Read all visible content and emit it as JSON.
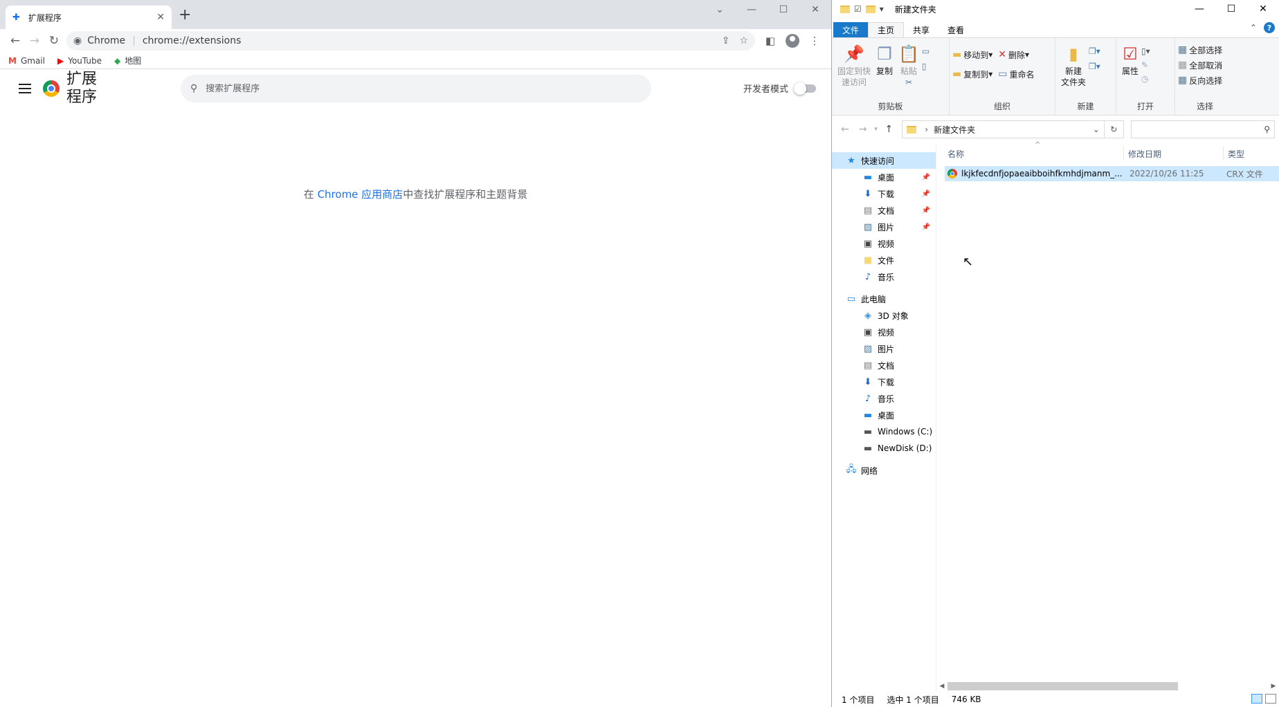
{
  "chrome": {
    "tab": {
      "title": "扩展程序",
      "close": "✕"
    },
    "newtab": "+",
    "window": {
      "minimize": "—",
      "maximize": "☐",
      "close": "✕",
      "tab_search": "⌄"
    },
    "omnibox": {
      "site_name": "Chrome",
      "separator": "|",
      "url": "chrome://extensions"
    },
    "bookmarks": [
      {
        "label": "Gmail",
        "icon": "M",
        "icon_color": "#ea4335"
      },
      {
        "label": "YouTube",
        "icon": "▶",
        "icon_color": "#ff0000"
      },
      {
        "label": "地图",
        "icon": "◆",
        "icon_color": "#34a853"
      }
    ],
    "extensions_page": {
      "title": "扩展 程序",
      "search_placeholder": "搜索扩展程序",
      "dev_mode_label": "开发者模式",
      "dev_mode_on": false,
      "store_msg_prefix": "在 ",
      "store_msg_link": "Chrome 应用商店",
      "store_msg_suffix": "中查找扩展程序和主题背景"
    }
  },
  "explorer": {
    "title": "新建文件夹",
    "ribbon_tabs": [
      "文件",
      "主页",
      "共享",
      "查看"
    ],
    "active_tab": "主页",
    "ribbon": {
      "clipboard": {
        "label": "剪贴板",
        "pin": "固定到快\n速访问",
        "copy": "复制",
        "paste": "粘贴"
      },
      "organize": {
        "label": "组织",
        "move_to": "移动到",
        "copy_to": "复制到",
        "delete": "删除",
        "rename": "重命名"
      },
      "new": {
        "label": "新建",
        "new_folder": "新建\n文件夹"
      },
      "open": {
        "label": "打开",
        "properties": "属性"
      },
      "select": {
        "label": "选择",
        "select_all": "全部选择",
        "select_none": "全部取消",
        "invert": "反向选择"
      }
    },
    "address": {
      "path": "新建文件夹"
    },
    "nav": {
      "quick_access": "快速访问",
      "quick_items": [
        {
          "label": "桌面",
          "icon": "▬",
          "color": "#1e88e5",
          "pinned": true
        },
        {
          "label": "下载",
          "icon": "⬇",
          "color": "#1e63c5",
          "pinned": true
        },
        {
          "label": "文档",
          "icon": "▤",
          "color": "#777",
          "pinned": true
        },
        {
          "label": "图片",
          "icon": "▨",
          "color": "#4a7aa8",
          "pinned": true
        },
        {
          "label": "视频",
          "icon": "▣",
          "color": "#444",
          "pinned": false
        },
        {
          "label": "文件",
          "icon": "■",
          "color": "#f8d775",
          "pinned": false
        },
        {
          "label": "音乐",
          "icon": "♪",
          "color": "#1e63c5",
          "pinned": false
        }
      ],
      "this_pc": "此电脑",
      "pc_items": [
        {
          "label": "3D 对象",
          "icon": "◈",
          "color": "#3a8ee6"
        },
        {
          "label": "视频",
          "icon": "▣",
          "color": "#444"
        },
        {
          "label": "图片",
          "icon": "▨",
          "color": "#4a7aa8"
        },
        {
          "label": "文档",
          "icon": "▤",
          "color": "#777"
        },
        {
          "label": "下载",
          "icon": "⬇",
          "color": "#1e63c5"
        },
        {
          "label": "音乐",
          "icon": "♪",
          "color": "#1e63c5"
        },
        {
          "label": "桌面",
          "icon": "▬",
          "color": "#1e88e5"
        },
        {
          "label": "Windows (C:)",
          "icon": "▬",
          "color": "#555"
        },
        {
          "label": "NewDisk (D:)",
          "icon": "▬",
          "color": "#555"
        }
      ],
      "network": "网络"
    },
    "columns": {
      "name": "名称",
      "date": "修改日期",
      "type": "类型"
    },
    "file": {
      "name": "lkjkfecdnfjopaeaibboihfkmhdjmanm_...",
      "date": "2022/10/26 11:25",
      "type": "CRX 文件"
    },
    "status": {
      "count": "1 个项目",
      "selected": "选中 1 个项目",
      "size": "746 KB"
    }
  }
}
